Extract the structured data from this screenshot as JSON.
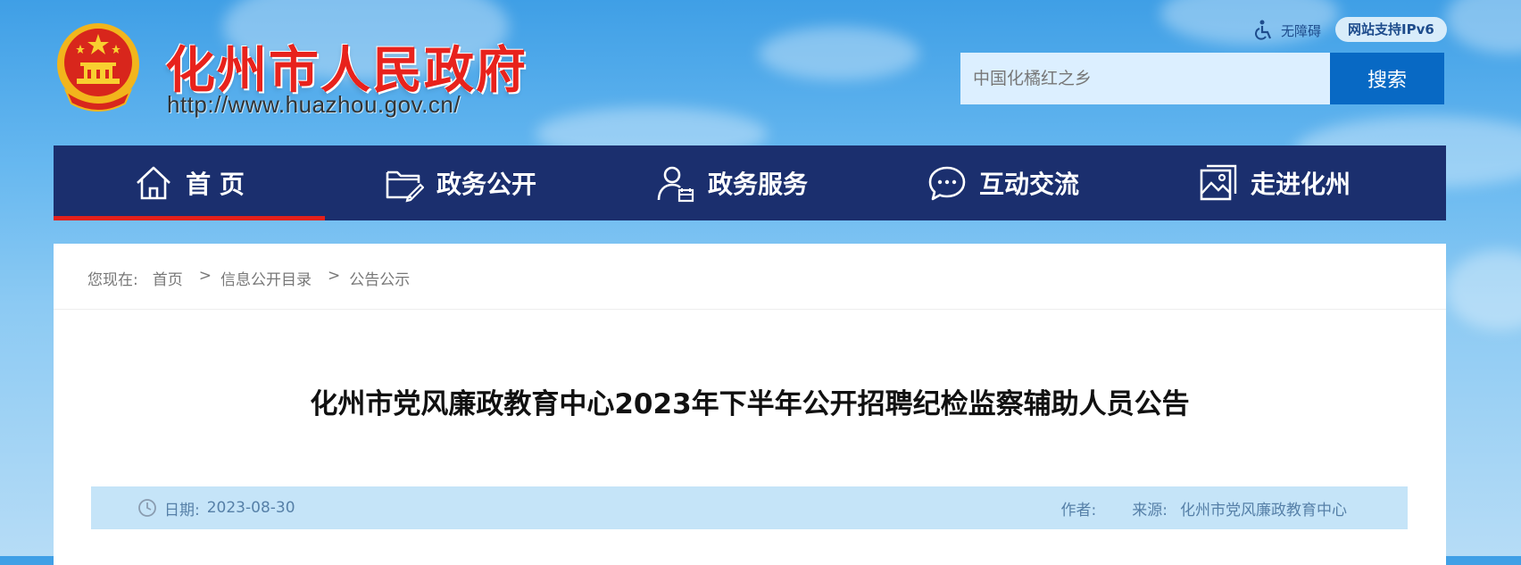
{
  "header": {
    "site_title": "化州市人民政府",
    "site_url": "http://www.huazhou.gov.cn/",
    "accessibility_label": "无障碍",
    "ipv6_badge": "网站支持IPv6",
    "search": {
      "placeholder": "中国化橘红之乡",
      "button_label": "搜索"
    }
  },
  "nav": {
    "items": [
      {
        "label": "首 页",
        "icon": "home-icon",
        "active": true
      },
      {
        "label": "政务公开",
        "icon": "folder-edit-icon"
      },
      {
        "label": "政务服务",
        "icon": "user-calendar-icon"
      },
      {
        "label": "互动交流",
        "icon": "chat-bubble-icon"
      },
      {
        "label": "走进化州",
        "icon": "picture-icon"
      }
    ],
    "active_color": "#e3201b",
    "bar_color": "#1b2f6e"
  },
  "breadcrumb": {
    "prefix": "您现在:",
    "items": [
      "首页",
      "信息公开目录",
      "公告公示"
    ],
    "separator": ">"
  },
  "article": {
    "title": "化州市党风廉政教育中心2023年下半年公开招聘纪检监察辅助人员公告",
    "date_label": "日期:",
    "date": "2023-08-30",
    "author_label": "作者:",
    "author": "",
    "source_label": "来源:",
    "source": "化州市党风廉政教育中心"
  }
}
